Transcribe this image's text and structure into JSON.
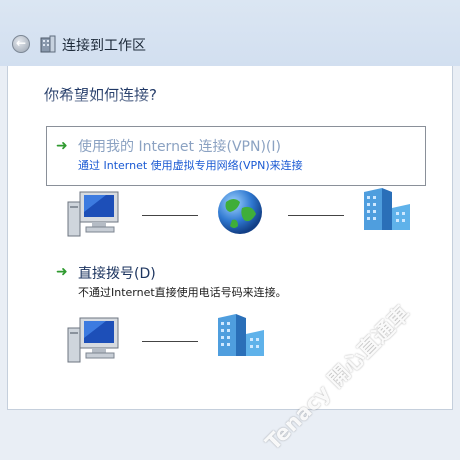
{
  "window": {
    "title": "连接到工作区",
    "back_label": "←"
  },
  "content": {
    "question": "你希望如何连接?",
    "options": [
      {
        "arrow": "➜",
        "title": "使用我的 Internet 连接(VPN)(I)",
        "description": "通过 Internet 使用虚拟专用网络(VPN)来连接",
        "selected": true
      },
      {
        "arrow": "➜",
        "title": "直接拨号(D)",
        "description": "不通过Internet直接使用电话号码来连接。",
        "selected": false
      }
    ]
  },
  "icons": {
    "vpn_row": [
      "computer-icon",
      "globe-icon",
      "office-building-icon"
    ],
    "dial_row": [
      "computer-icon",
      "office-building-icon"
    ]
  },
  "watermark": "Tenacy 開心直通車",
  "colors": {
    "title_bar": "#d2dff0",
    "option_title_selected": "#8ba2c2",
    "option_desc_selected": "#1a5ad3",
    "option_arrow": "#2f9a2f",
    "question_text": "#1a3362"
  }
}
